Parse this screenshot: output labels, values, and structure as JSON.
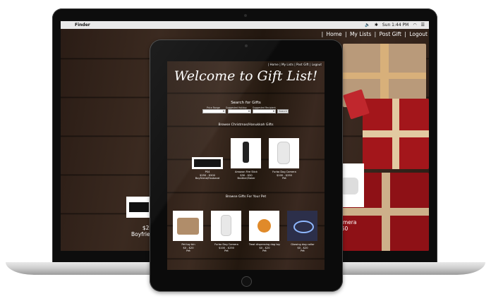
{
  "menubar": {
    "app_name": "Finder",
    "time": "Sun 1:44 PM"
  },
  "nav": {
    "home": "Home",
    "my_lists": "My Lists",
    "post_gift": "Post Gift",
    "logout": "Logout",
    "separator": "|"
  },
  "page": {
    "title": "Welcome to Gift List!"
  },
  "search": {
    "title": "Search for Gifts",
    "filters": [
      {
        "label": "Price Range"
      },
      {
        "label": "Suggested Holiday"
      },
      {
        "label": "Suggested Recipient"
      }
    ],
    "button": "Search"
  },
  "sections": {
    "christmas": "Browse Christmas/Hanukkah Gifts",
    "pet": "Browse Gifts For Your Pet"
  },
  "christmas_items": [
    {
      "name": "PS4",
      "price": "$250 - $500",
      "recipient": "Boyfriend/Husband"
    },
    {
      "name": "Amazon Fire Stick",
      "price": "$30 - $50",
      "recipient": "Brother/Sister"
    },
    {
      "name": "Furbo Dog Camera",
      "price": "$100 - $250",
      "recipient": "Pet"
    }
  ],
  "pet_items": [
    {
      "name": "Pet toy bin",
      "price": "$0 - $20",
      "recipient": "Pet"
    },
    {
      "name": "Furbo Dog Camera",
      "price": "$100 - $250",
      "recipient": "Pet"
    },
    {
      "name": "Treat dispensing dog toy",
      "price": "$0 - $20",
      "recipient": "Pet"
    },
    {
      "name": "Glowing dog collar",
      "price": "$0 - $20",
      "recipient": "Pet"
    }
  ],
  "laptop_partial": {
    "left_price": "$25",
    "left_recipient": "Boyfrie",
    "right_name": "Camera",
    "right_price": "250"
  },
  "colors": {
    "wood_dark": "#2b1d15",
    "ribbon": "#d8b07a",
    "gift_red": "#a3161b"
  }
}
